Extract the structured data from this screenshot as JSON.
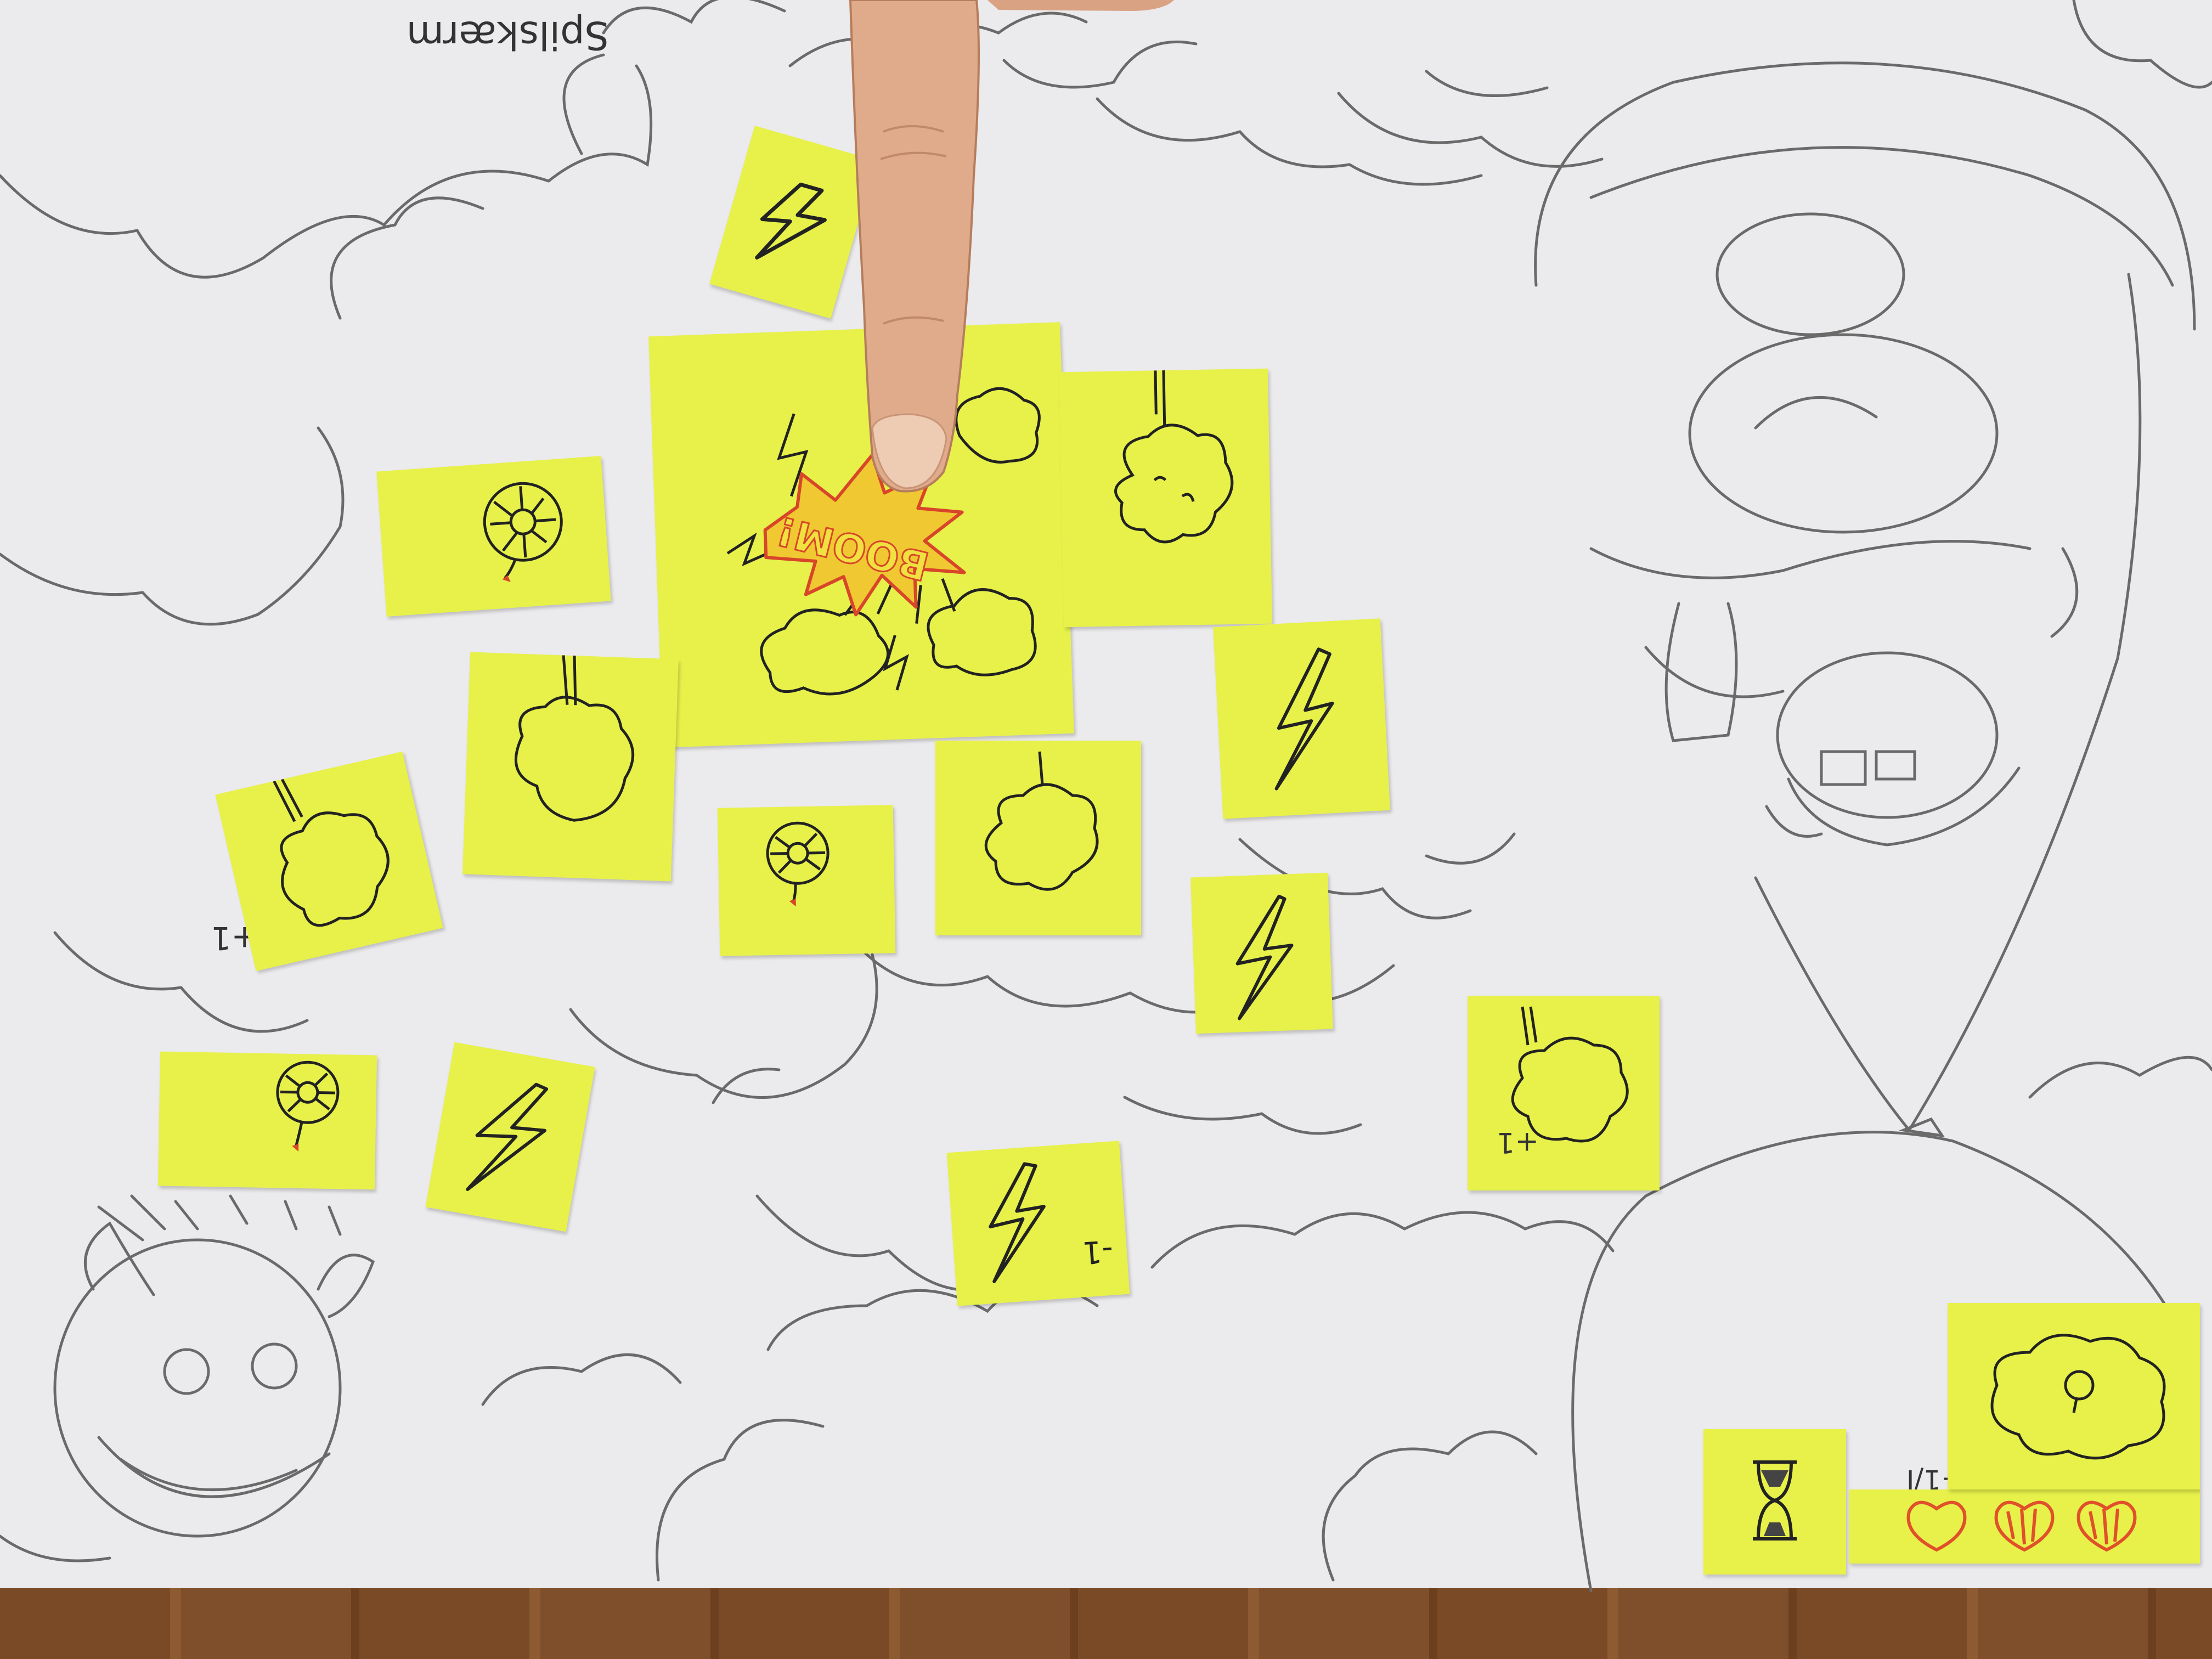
{
  "sheet": {
    "title_text": "Spilskærm",
    "boom_text": "BOOM!",
    "plus_one_text": "+1",
    "minus_one_text": "-1",
    "timer_label": "+1/I"
  },
  "colors": {
    "note_yellow": "#e7f14a",
    "paper": "#ebeaec",
    "pencil": "#555555",
    "boom_red": "#d8462a",
    "heart_red": "#e0502a",
    "skin": "#e0ab8a"
  },
  "icons": {
    "lightning": "lightning-bolt-icon",
    "cloud": "cloud-icon",
    "balloon": "balloon-icon",
    "spider": "spider-icon",
    "hourglass": "hourglass-icon",
    "heart": "heart-icon"
  },
  "lives": {
    "filled": 1,
    "empty": 2
  }
}
